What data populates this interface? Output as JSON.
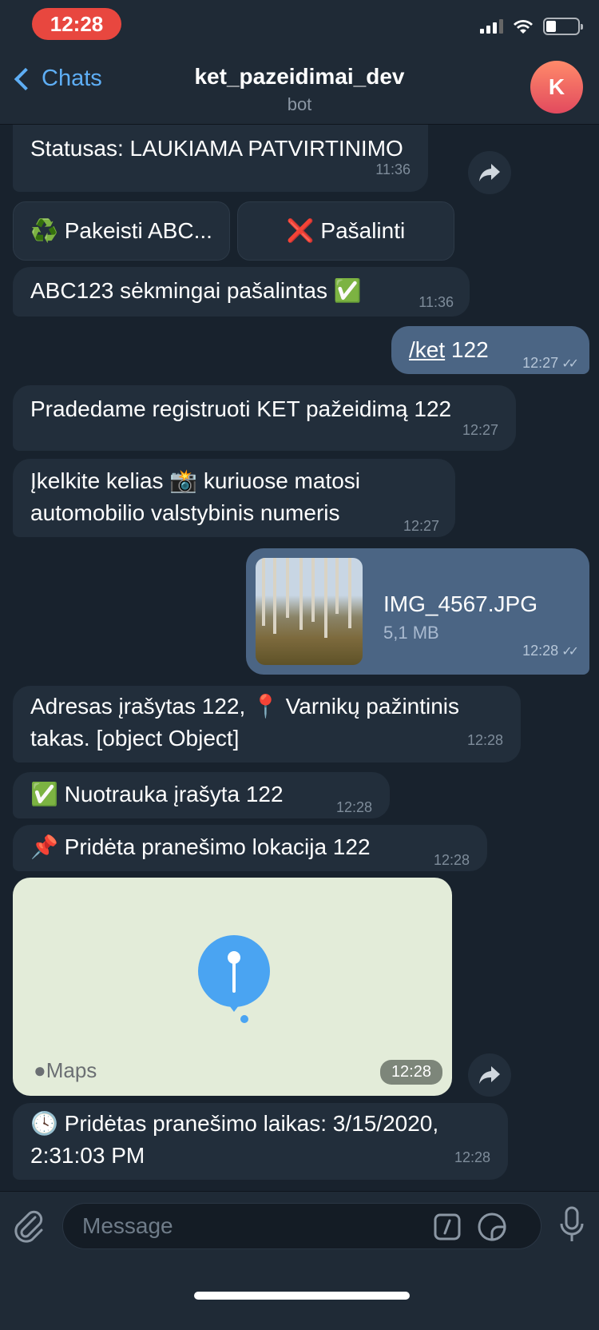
{
  "status_bar": {
    "time": "12:28"
  },
  "header": {
    "back_label": "Chats",
    "title": "ket_pazeidimai_dev",
    "subtitle": "bot",
    "avatar_initial": "K"
  },
  "messages": {
    "m0": {
      "text": "Statusas: LAUKIAMA PATVIRTINIMO",
      "time": "11:36"
    },
    "keyboard": {
      "btn1": "♻️ Pakeisti ABC...",
      "btn2": "❌ Pašalinti"
    },
    "m1": {
      "text": "ABC123 sėkmingai pašalintas ✅",
      "time": "11:36"
    },
    "m2": {
      "command": "/ket",
      "text": " 122",
      "time": "12:27"
    },
    "m3": {
      "text": "Pradedame registruoti KET pažeidimą 122",
      "time": "12:27"
    },
    "m4": {
      "line1": "Įkelkite kelias 📸 kuriuose matosi",
      "line2": "automobilio valstybinis numeris",
      "time": "12:27"
    },
    "m5": {
      "file_name": "IMG_4567.JPG",
      "file_size": "5,1 MB",
      "time": "12:28"
    },
    "m6": {
      "line1": "Adresas įrašytas 122, 📍 Varnikų pažintinis",
      "line2": "takas. [object Object]",
      "time": "12:28"
    },
    "m7": {
      "text": "✅ Nuotrauka įrašyta 122",
      "time": "12:28"
    },
    "m8": {
      "text": "📌 Pridėta pranešimo lokacija 122",
      "time": "12:28"
    },
    "map": {
      "label": "Maps",
      "time": "12:28"
    },
    "m9": {
      "line1": "🕓 Pridėtas pranešimo laikas: 3/15/2020,",
      "line2": "2:31:03 PM",
      "time": "12:28"
    }
  },
  "input": {
    "placeholder": "Message"
  },
  "colors": {
    "background": "#18222d",
    "incoming_bubble": "#222e3b",
    "outgoing_bubble": "#4b6584",
    "accent": "#5eaef5",
    "time_pill": "#e8473f"
  }
}
